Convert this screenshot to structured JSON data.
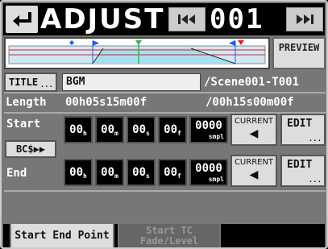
{
  "header": {
    "title": "ADJUST",
    "track_number": "001"
  },
  "fade_display": {
    "preview_label": "PREVIEW"
  },
  "title_row": {
    "button_label": "TITLE",
    "button_dots": "...",
    "value": "BGM",
    "suffix": "/Scene001-T001"
  },
  "length_row": {
    "label": "Length",
    "value": "00h05s15m00f",
    "total": "/00h15s00m00f"
  },
  "start": {
    "label": "Start",
    "hours": "00",
    "hours_unit": "h",
    "minutes": "00",
    "minutes_unit": "m",
    "seconds": "00",
    "seconds_unit": "s",
    "frames": "00",
    "frames_unit": "f",
    "samples": "0000",
    "samples_unit": "smpl",
    "current_label": "CURRENT",
    "edit_label": "EDIT",
    "edit_dots": "..."
  },
  "end": {
    "label": "End",
    "hours": "00",
    "hours_unit": "h",
    "minutes": "00",
    "minutes_unit": "m",
    "seconds": "00",
    "seconds_unit": "s",
    "frames": "00",
    "frames_unit": "f",
    "samples": "0000",
    "samples_unit": "smpl",
    "current_label": "CURRENT",
    "edit_label": "EDIT",
    "edit_dots": "..."
  },
  "bcs_button": "BC$▶▶",
  "tabs": {
    "active": "Start End Point",
    "inactive_line1": "Start TC",
    "inactive_line2": "Fade/Level"
  },
  "colors": {
    "background": "#777777",
    "header": "#000000",
    "button": "#dddddd",
    "fade_fill": "#a8dff0",
    "start_marker": "#1a5cff",
    "end_marker": "#1a5cff",
    "playhead": "#2fb84a",
    "level_line": "#e02020"
  }
}
